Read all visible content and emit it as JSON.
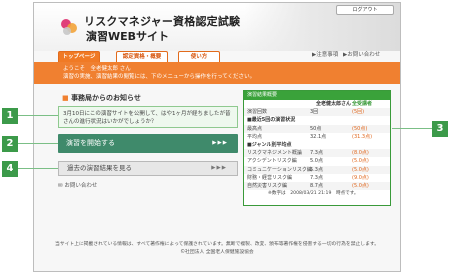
{
  "header": {
    "logout_label": "ログアウト",
    "title_line1": "リスクマネジャー資格認定試験",
    "title_line2": "演習WEBサイト"
  },
  "tabs": [
    {
      "label": "トップページ"
    },
    {
      "label": "認定資格・概要"
    },
    {
      "label": "使い方"
    }
  ],
  "header_links": {
    "notes": "▶注意事項",
    "contact": "▶お問い合わせ"
  },
  "welcome": {
    "line1": "ようこそ　全老健太郎 さん",
    "line2": "演習の実施、演習結果の閲覧には、下のメニューから操作を行ってください。"
  },
  "notice": {
    "title": "事務局からのお知らせ",
    "body": "3月10日にこの演習サイトを公開して、はや1ヶ月が経ちましたが皆さんの進行状況はいかがでしょうか？"
  },
  "buttons": {
    "start": "演習を開始する",
    "past": "過去の演習結果を見る",
    "arrows": "▶▶▶"
  },
  "contact_link": "お問い合わせ",
  "results": {
    "heading": "演習結果概要",
    "user_name": "全老健太郎さん",
    "all_label": "全受講者",
    "attempts_label": "演習回数",
    "attempts_value": "3回",
    "attempts_all": "(5回)",
    "section1": "■最近5回の演習状況",
    "best_label": "最高点",
    "best_value": "50点",
    "best_all": "(50点)",
    "avg_label": "平均点",
    "avg_value": "32.1点",
    "avg_all": "(31.3点)",
    "section2": "■ジャンル別平均点",
    "genres": [
      {
        "label": "リスクマネジメント概論",
        "value": "7.3点",
        "all": "(8.0点)"
      },
      {
        "label": "アクシデントリスク編",
        "value": "5.0点",
        "all": "(5.0点)"
      },
      {
        "label": "コミュニケーションリスク編",
        "value": "5.3点",
        "all": "(5.0点)"
      },
      {
        "label": "財務・経営リスク編",
        "value": "7.3点",
        "all": "(9.0点)"
      },
      {
        "label": "自然災害リスク編",
        "value": "8.7点",
        "all": "(5.0点)"
      }
    ],
    "footnote": "※数字は　2008/03/21 21:19　時点です。"
  },
  "footer": {
    "line1": "当サイト上に掲載されている情報は、すべて著作権によって保護されています。無断で複製、改変、頒布等著作権を侵害する一切の行為を禁止します。",
    "line2": "©社団法人 全国老人保健施設協会"
  },
  "callouts": [
    "1",
    "2",
    "3",
    "4"
  ],
  "colors": {
    "orange": "#f08030",
    "green": "#3c9a4a",
    "button_green": "#3f8a6b"
  }
}
